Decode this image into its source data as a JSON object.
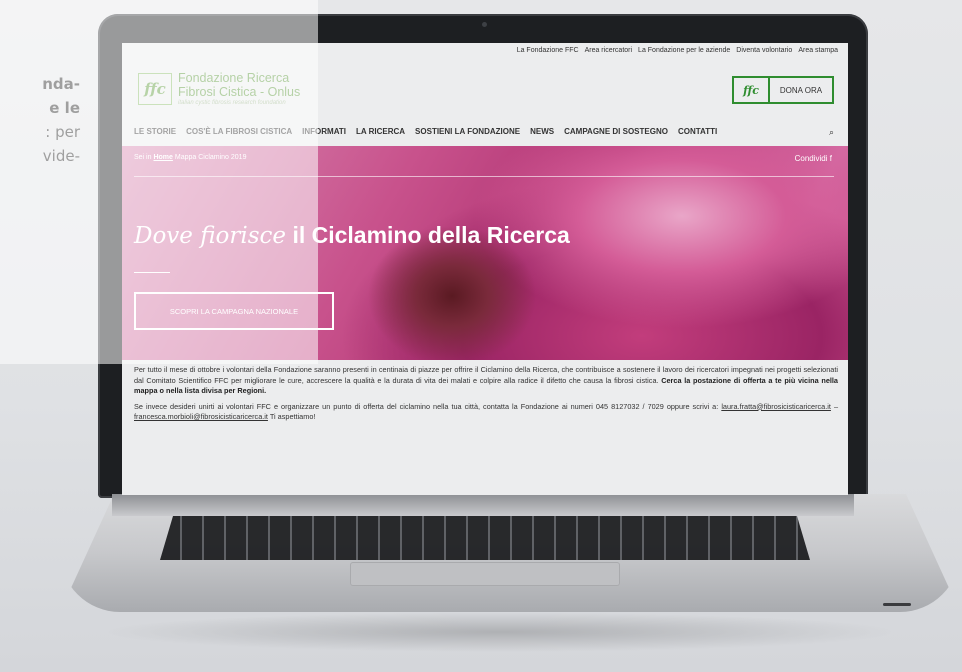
{
  "side_text": {
    "line1": "nda-",
    "line2": "e le",
    "line3": ": per",
    "line4": "vide-"
  },
  "site": {
    "top_nav": [
      "La Fondazione FFC",
      "Area ricercatori",
      "La Fondazione per le aziende",
      "Diventa volontario",
      "Area stampa"
    ],
    "logo": {
      "mark": "ffc",
      "title_line1": "Fondazione Ricerca",
      "title_line2": "Fibrosi Cistica - Onlus",
      "tagline": "italian cystic fibrosis research foundation"
    },
    "donate": {
      "mark": "ffc",
      "label": "DONA ORA"
    },
    "main_nav": [
      "LE STORIE",
      "COS'È LA FIBROSI CISTICA",
      "INFORMATI",
      "LA RICERCA",
      "SOSTIENI LA FONDAZIONE",
      "NEWS",
      "CAMPAGNE DI SOSTEGNO",
      "CONTATTI"
    ],
    "search_icon_glyph": "⌕",
    "hero": {
      "breadcrumb_prefix": "Sei in",
      "breadcrumb_home": "Home",
      "breadcrumb_current": "Mappa Ciclamino 2019",
      "share_label": "Condividi",
      "share_icon": "f",
      "title_italic": "Dove fiorisce",
      "title_bold": "il Ciclamino della Ricerca",
      "cta": "SCOPRI LA CAMPAGNA NAZIONALE"
    },
    "body": {
      "p1_text": "Per tutto il mese di ottobre i volontari della Fondazione saranno presenti in centinaia di piazze per offrire il Ciclamino della Ricerca, che contribuisce a sostenere il lavoro dei ricercatori impegnati nei progetti selezionati dal Comitato Scientifico FFC per migliorare le cure, accrescere la qualità e la durata di vita dei malati e colpire alla radice il difetto che causa la fibrosi cistica.",
      "p1_bold": "Cerca la postazione di offerta a te più vicina nella mappa o nella lista divisa per Regioni.",
      "p2_text": "Se invece desideri unirti ai volontari FFC e organizzare un punto di offerta del ciclamino nella tua città, contatta la Fondazione ai numeri 045 8127032 / 7029 oppure scrivi a:",
      "email1": "laura.fratta@fibrosicisticaricerca.it",
      "separator": "–",
      "email2": "francesca.morbioli@fibrosicisticaricerca.it",
      "closing": "Ti aspettiamo!"
    }
  }
}
